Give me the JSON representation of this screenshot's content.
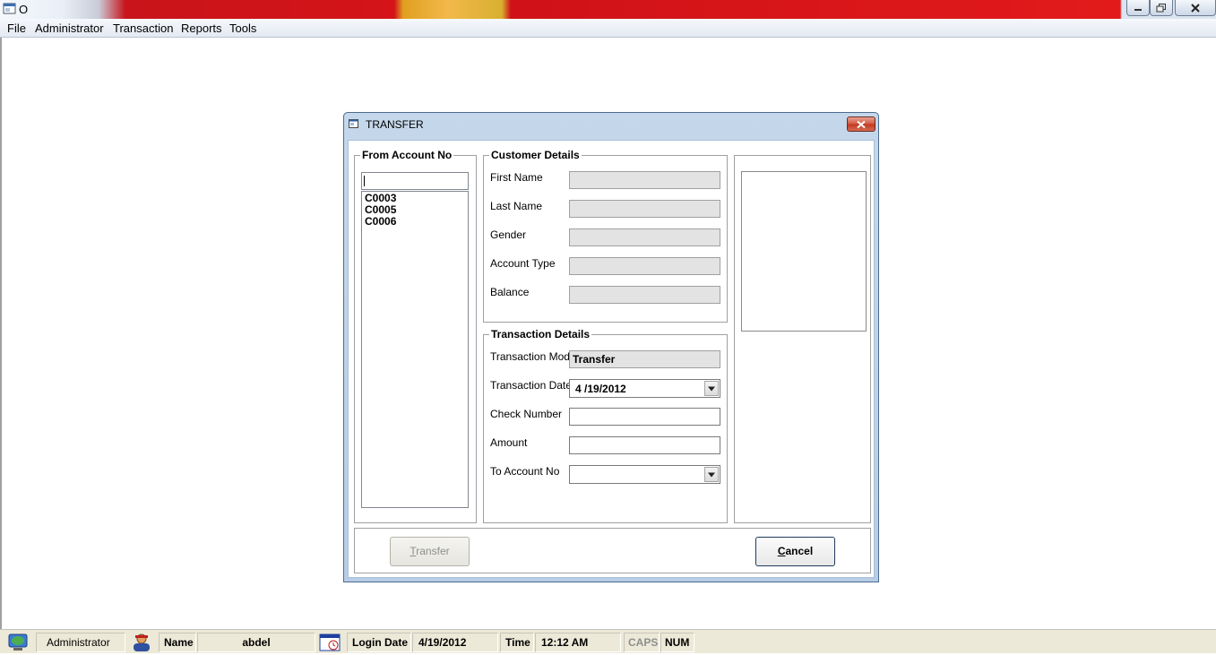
{
  "window": {
    "title": "O"
  },
  "menu": {
    "items": [
      "File",
      "Administrator",
      "Transaction",
      "Reports",
      "Tools"
    ]
  },
  "dialog": {
    "title": "TRANSFER",
    "from_account": {
      "label": "From Account No",
      "search_value": "",
      "accounts": [
        "C0003",
        "C0005",
        "C0006"
      ]
    },
    "customer_details": {
      "title": "Customer Details",
      "first_name_label": "First Name",
      "last_name_label": "Last Name",
      "gender_label": "Gender",
      "account_type_label": "Account Type",
      "balance_label": "Balance"
    },
    "transaction_details": {
      "title": "Transaction Details",
      "mode_label": "Transaction Mode",
      "mode_value": "Transfer",
      "date_label": "Transaction Date",
      "date_value": "4 /19/2012",
      "check_label": "Check Number",
      "amount_label": "Amount",
      "to_account_label": "To Account No",
      "to_account_value": ""
    },
    "buttons": {
      "transfer_accel": "T",
      "transfer_rest": "ransfer",
      "cancel_accel": "C",
      "cancel_rest": "ancel"
    }
  },
  "statusbar": {
    "user_role": "Administrator",
    "name_label": "Name",
    "name_value": "abdel",
    "login_date_label": "Login Date",
    "login_date_value": "4/19/2012",
    "time_label": "Time",
    "time_value": "12:12 AM",
    "caps": "CAPS",
    "num": "NUM"
  },
  "colors": {
    "dialog_frame": "#c5d7ea",
    "close_button": "#c2371e",
    "statusbar_bg": "#ece9d8"
  },
  "icons": {
    "app": "window-app-icon",
    "dialog": "dialog-window-icon",
    "role": "network-globe-icon",
    "user": "user-icon",
    "login": "calendar-clock-icon"
  }
}
